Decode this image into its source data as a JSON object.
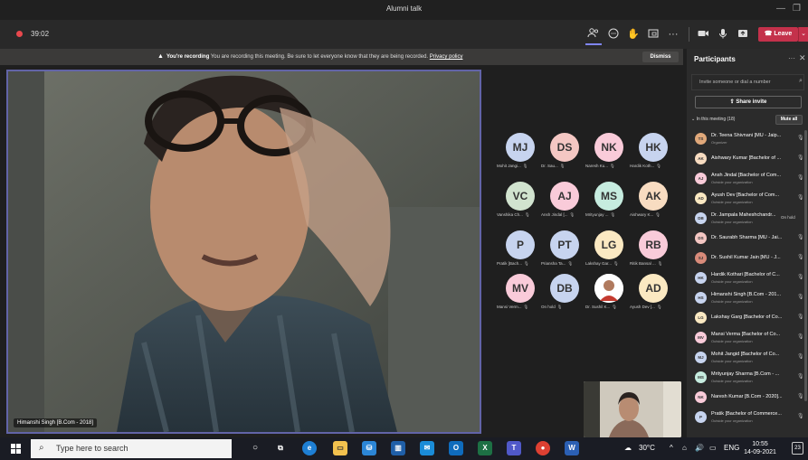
{
  "window": {
    "title": "Alumni talk"
  },
  "toolbar": {
    "timer": "39:02",
    "leave_label": "Leave"
  },
  "banner": {
    "bold": "You're recording",
    "message": "You are recording this meeting. Be sure to let everyone know that they are being recorded.",
    "link": "Privacy policy",
    "dismiss": "Dismiss"
  },
  "stage": {
    "main_video_name": "Himanshi Singh [B.Com - 2018]"
  },
  "grid": [
    {
      "initials": "MJ",
      "label": "Mohit Jangi...",
      "color": "#c7d4ef"
    },
    {
      "initials": "DS",
      "label": "Dr. Sau...",
      "color": "#f4c7c3"
    },
    {
      "initials": "NK",
      "label": "Naresh Ku...",
      "color": "#f9cbd9"
    },
    {
      "initials": "HK",
      "label": "Hardik Koth...",
      "color": "#c7d4ef"
    },
    {
      "initials": "VC",
      "label": "Vanshika Ch...",
      "color": "#d1e3cf"
    },
    {
      "initials": "AJ",
      "label": "Ansh Jindal [...",
      "color": "#f9cbd9"
    },
    {
      "initials": "MS",
      "label": "Mrityunjay ...",
      "color": "#c6ecdf"
    },
    {
      "initials": "AK",
      "label": "Aishwary K...",
      "color": "#f8dcc1"
    },
    {
      "initials": "P",
      "label": "Pratik [Bach...",
      "color": "#c7d4ef"
    },
    {
      "initials": "PT",
      "label": "Priansha Ta...",
      "color": "#c7d4ef"
    },
    {
      "initials": "LG",
      "label": "Lakshay Gar...",
      "color": "#fbe9c2"
    },
    {
      "initials": "RB",
      "label": "Ritik Bansal ...",
      "color": "#f9cbd9"
    },
    {
      "initials": "MV",
      "label": "Mansi Verm...",
      "color": "#f9cbd9"
    },
    {
      "initials": "DB",
      "label": "On hold",
      "color": "#c7d4ef"
    },
    {
      "initials": "",
      "label": "Dr. Sushil K...",
      "color": "#ffffff"
    },
    {
      "initials": "AD",
      "label": "Ayush Dev [...",
      "color": "#fbe9c2"
    }
  ],
  "panel": {
    "title": "Participants",
    "invite_placeholder": "Invite someone or dial a number",
    "share_invite": "Share invite",
    "section": "In this meeting (18)",
    "mute_all": "Mute all",
    "participants": [
      {
        "initials": "TS",
        "name": "Dr. Teena Shivnani [MU - Jaip...",
        "sub": "Organizer",
        "color": "#e0a87a",
        "status": ""
      },
      {
        "initials": "AK",
        "name": "Aishwary Kumar [Bachelor of ...",
        "sub": "",
        "color": "#f8dcc1",
        "status": ""
      },
      {
        "initials": "AJ",
        "name": "Ansh Jindal [Bachelor of Com...",
        "sub": "Outside your organization",
        "color": "#f9cbd9",
        "status": ""
      },
      {
        "initials": "AD",
        "name": "Ayush Dev [Bachelor of Com...",
        "sub": "Outside your organization",
        "color": "#fbe9c2",
        "status": ""
      },
      {
        "initials": "DB",
        "name": "Dr. Jampala Maheshchandr...",
        "sub": "Outside your organization",
        "color": "#c7d4ef",
        "status": "On hold"
      },
      {
        "initials": "DS",
        "name": "Dr. Saurabh Sharma [MU - Jai...",
        "sub": "",
        "color": "#f4c7c3",
        "status": ""
      },
      {
        "initials": "SJ",
        "name": "Dr. Sushil Kumar Jain [MU - J...",
        "sub": "",
        "color": "#d98b7a",
        "status": ""
      },
      {
        "initials": "HK",
        "name": "Hardik Kothari [Bachelor of C...",
        "sub": "Outside your organization",
        "color": "#c7d4ef",
        "status": ""
      },
      {
        "initials": "HS",
        "name": "Himanshi Singh [B.Com - 201...",
        "sub": "Outside your organization",
        "color": "#c7d4ef",
        "status": ""
      },
      {
        "initials": "LG",
        "name": "Lakshay Garg [Bachelor of Co...",
        "sub": "",
        "color": "#fbe9c2",
        "status": ""
      },
      {
        "initials": "MV",
        "name": "Mansi Verma [Bachelor of Co...",
        "sub": "Outside your organization",
        "color": "#f9cbd9",
        "status": ""
      },
      {
        "initials": "MJ",
        "name": "Mohit Jangid [Bachelor of Co...",
        "sub": "Outside your organization",
        "color": "#c7d4ef",
        "status": ""
      },
      {
        "initials": "MS",
        "name": "Mrityunjay Sharma [B.Com - ...",
        "sub": "Outside your organization",
        "color": "#c6ecdf",
        "status": ""
      },
      {
        "initials": "NK",
        "name": "Naresh Kumar [B.Com - 2020]...",
        "sub": "",
        "color": "#f9cbd9",
        "status": ""
      },
      {
        "initials": "P",
        "name": "Pratik [Bachelor of Commerce...",
        "sub": "Outside your organization",
        "color": "#c7d4ef",
        "status": ""
      }
    ]
  },
  "taskbar": {
    "search_placeholder": "Type here to search",
    "temperature": "30°C",
    "language": "ENG",
    "time": "10:55",
    "date": "14-09-2021",
    "notifications": "23"
  }
}
